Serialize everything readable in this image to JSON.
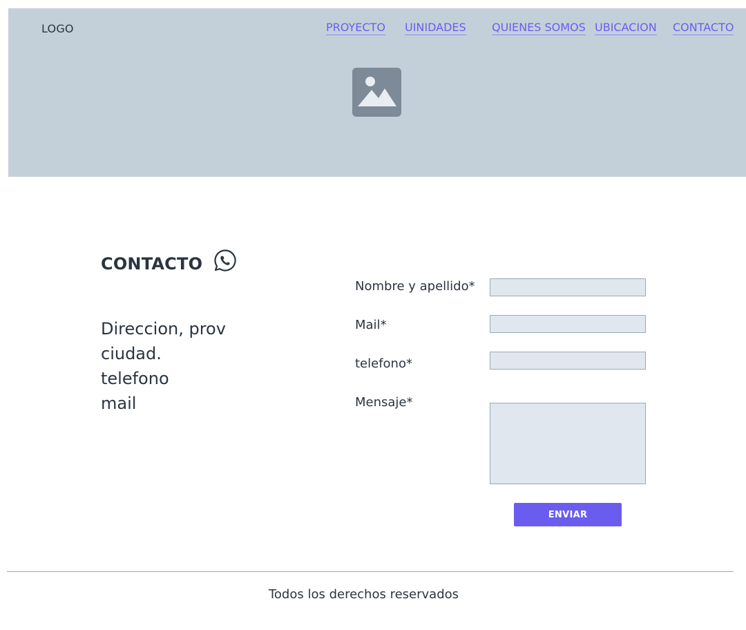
{
  "header": {
    "logo": "LOGO",
    "nav": [
      {
        "label": "PROYECTO"
      },
      {
        "label": "UINIDADES"
      },
      {
        "label": "QUIENES SOMOS "
      },
      {
        "label": "UBICACION "
      },
      {
        "label": "CONTACTO"
      }
    ],
    "hero_image_icon": "image-placeholder-icon"
  },
  "contact": {
    "title": "CONTACTO",
    "whatsapp_icon": "whatsapp-icon",
    "address_lines": [
      "Direccion, prov",
      "ciudad.",
      "telefono",
      "mail"
    ]
  },
  "form": {
    "fields": [
      {
        "label": "Nombre y apellido*",
        "value": ""
      },
      {
        "label": "Mail*",
        "value": ""
      },
      {
        "label": "telefono*",
        "value": ""
      },
      {
        "label": "Mensaje*",
        "value": ""
      }
    ],
    "submit_label": "ENVIAR"
  },
  "footer": {
    "text": "Todos los derechos reservados"
  },
  "colors": {
    "hero_bg": "#c4d0d9",
    "accent": "#6b5cf0",
    "input_bg": "#e1e7ee",
    "input_border": "#9aa8b5",
    "text": "#2b3440"
  }
}
